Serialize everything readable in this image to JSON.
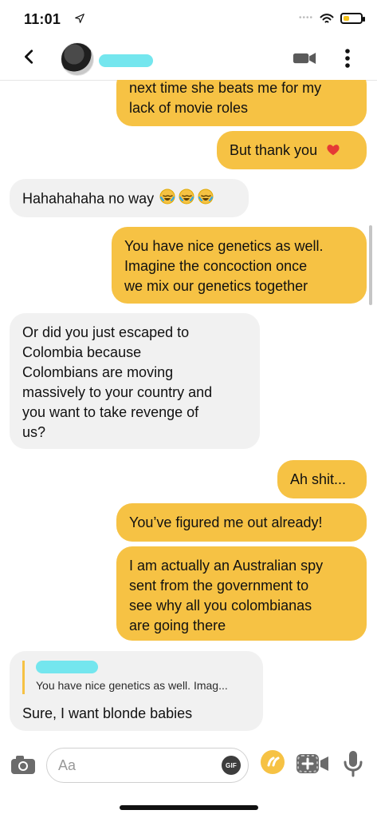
{
  "status": {
    "time": "11:01",
    "battery_level": 0.35
  },
  "header": {
    "back_icon": "chevron-left-icon",
    "video_icon": "video-camera-icon",
    "more_icon": "more-vertical-icon"
  },
  "messages": [
    {
      "from": "me",
      "text": "next time she beats me for my\nlack of movie roles"
    },
    {
      "from": "me",
      "text": "But thank you",
      "emoji": "heart-icon"
    },
    {
      "from": "them",
      "text": "Hahahahaha no way",
      "emoji": "laughing-with-tears-emoji"
    },
    {
      "from": "me",
      "text": "You have nice genetics as well.\nImagine the concoction once\nwe mix our genetics together"
    },
    {
      "from": "them",
      "text": "Or did you just escaped to\nColombia because\nColombians are moving\nmassively to your country and\nyou want to take revenge of\nus?"
    },
    {
      "from": "me",
      "text": "Ah shit..."
    },
    {
      "from": "me",
      "text": "You’ve figured me out already!"
    },
    {
      "from": "me",
      "text": "I am actually an Australian spy\nsent from the government to\nsee why all you colombianas\nare going there"
    }
  ],
  "reply": {
    "quoted_snippet": "You have nice genetics as well. Imag...",
    "text": "Sure, I want blonde babies"
  },
  "composer": {
    "placeholder": "Aa",
    "gif_label": "GIF",
    "camera_icon": "camera-icon",
    "quick_reply_icon": "quote-bubble-icon",
    "video_message_icon": "video-add-icon",
    "mic_icon": "microphone-icon"
  },
  "colors": {
    "accent": "#F6C244",
    "incoming_bubble": "#F1F1F1",
    "redaction": "#74E6EE"
  }
}
